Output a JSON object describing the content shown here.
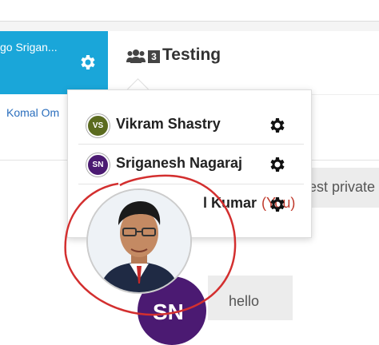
{
  "left_tab": {
    "text": "go  Srigan..."
  },
  "chat": {
    "member_count": "3",
    "title": "Testing"
  },
  "sidebar": {
    "subtitle": "Komal Om"
  },
  "members": [
    {
      "initials": "VS",
      "name": "Vikram Shastry",
      "you": "",
      "color": "#5b6b1f"
    },
    {
      "initials": "SN",
      "name": "Sriganesh Nagaraj",
      "you": "",
      "color": "#4b1a72"
    },
    {
      "initials": "",
      "name": "l Kumar",
      "you": "(You)",
      "color": "#888888"
    }
  ],
  "messages": {
    "private_fragment": "est private",
    "hello": "hello"
  },
  "purple_avatar": {
    "initials": "SN"
  },
  "colors": {
    "accent": "#1aa6d9",
    "annotation": "#d32f2f",
    "you": "#c0392b"
  }
}
